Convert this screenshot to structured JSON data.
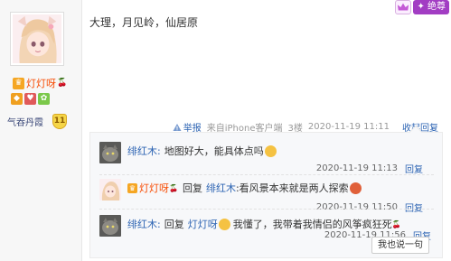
{
  "author": {
    "name": "灯灯呀",
    "level_name": "气吞丹霞",
    "level_num": "11"
  },
  "header": {
    "vip_label": "✦ 绝尊"
  },
  "post": {
    "text": "大理，月见岭，仙居原",
    "meta": {
      "report_label": "举报",
      "source": "来自iPhone客户端",
      "floor": "3楼",
      "time": "2020-11-19 11:11",
      "reply_toggle": "收起回复"
    }
  },
  "replies": [
    {
      "user": "绯红木:",
      "text": "地图好大，能具体点吗",
      "time": "2020-11-19 11:13",
      "reply_label": "回复"
    },
    {
      "user": "灯灯呀",
      "reply_word": "回复",
      "target": "绯红木",
      "text": ":看风景本来就是两人探索",
      "time": "2020-11-19 11:50",
      "reply_label": "回复"
    },
    {
      "user": "绯红木:",
      "reply_word": "回复",
      "target": "灯灯呀",
      "text": "我懂了，我带着我情侣的风筝疯狂死",
      "time": "2020-11-19 11:56",
      "reply_label": "回复"
    }
  ],
  "say_button": "我也说一句",
  "colors": {
    "link": "#2d64b3",
    "username_vip": "#f74a00",
    "vip_badge": "#a23dc3"
  }
}
